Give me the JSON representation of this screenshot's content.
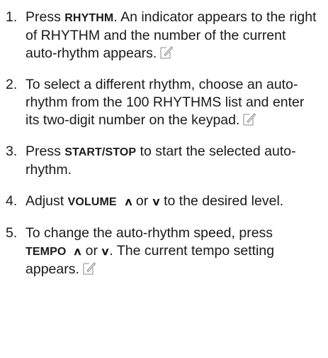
{
  "steps": [
    {
      "number": "1.",
      "pre": "Press ",
      "key": "RHYTHM",
      "post": ". An indicator appears to the right of RHYTHM and the number of the current auto-rhythm appears.",
      "note_icon": "note-icon"
    },
    {
      "number": "2.",
      "text": "To select a different rhythm, choose an auto-rhythm from the 100 RHYTHMS list and enter its two-digit number on the keypad.",
      "note_icon": "note-icon"
    },
    {
      "number": "3.",
      "pre": "Press ",
      "key": "START/STOP",
      "post": " to start the selected auto-rhythm."
    },
    {
      "number": "4.",
      "pre": "Adjust ",
      "key": "VOLUME",
      "up_arrow": "∧",
      "or": " or ",
      "down_arrow": "∨",
      "post": " to the desired level."
    },
    {
      "number": "5.",
      "pre": "To change the auto-rhythm speed, press ",
      "key": "TEMPO",
      "up_arrow": "∧",
      "or": " or ",
      "down_arrow": "∨",
      "post": ". The current tempo setting appears.",
      "note_icon": "note-icon"
    }
  ]
}
